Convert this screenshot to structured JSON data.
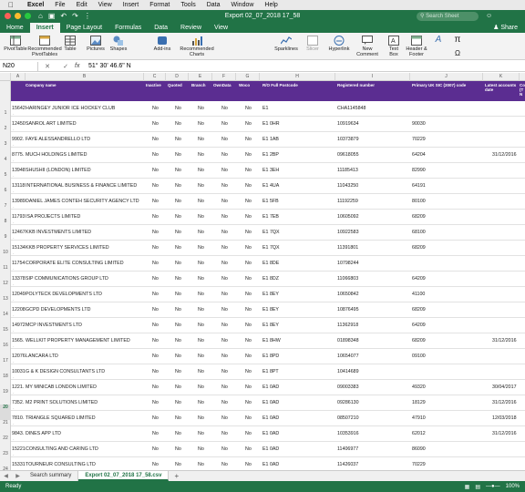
{
  "menubar": {
    "app": "Excel",
    "items": [
      "File",
      "Edit",
      "View",
      "Insert",
      "Format",
      "Tools",
      "Data",
      "Window",
      "Help"
    ]
  },
  "titlebar": {
    "title": "Export 02_07_2018 17_58",
    "search_placeholder": "Search Sheet",
    "share": "Share"
  },
  "ribbon_tabs": [
    "Home",
    "Insert",
    "Page Layout",
    "Formulas",
    "Data",
    "Review",
    "View"
  ],
  "active_tab": "Insert",
  "ribbon": {
    "pivottable": "PivotTable",
    "recommended_pivot": "Recommended PivotTables",
    "table": "Table",
    "pictures": "Pictures",
    "shapes": "Shapes",
    "addins": "Add-ins",
    "recommended_charts": "Recommended Charts",
    "sparklines": "Sparklines",
    "slicer": "Slicer",
    "hyperlink": "Hyperlink",
    "new_comment": "New Comment",
    "text_box": "Text Box",
    "header_footer": "Header & Footer"
  },
  "formula_bar": {
    "cell_ref": "N20",
    "fx": "fx",
    "value": "51° 30' 46.6\" N"
  },
  "columns": [
    "A",
    "B",
    "C",
    "D",
    "E",
    "F",
    "G",
    "H",
    "I",
    "J",
    "K",
    "L"
  ],
  "headers": {
    "company_name": "Company name",
    "inactive": "Inactive",
    "quoted": "Quoted",
    "branch": "Branch",
    "owndata": "OwnData",
    "woco": "Woco",
    "ro_full_postcode": "R/O Full Postcode",
    "registered_number": "Registered number",
    "primary_sic": "Primary UK SIC (2007) code",
    "latest_accounts": "Latest accounts date",
    "next": "Co (T N"
  },
  "rows": [
    {
      "rownum": "1",
      "id": "15642",
      "name": "HARINGEY JUNIOR ICE HOCKEY CLUB",
      "inactive": "No",
      "quoted": "No",
      "branch": "No",
      "owndata": "No",
      "woco": "No",
      "postcode": "E1",
      "regno": "CHA1145848",
      "sic": "",
      "accounts": ""
    },
    {
      "rownum": "2",
      "id": "12450",
      "name": "SANROL ART LIMITED",
      "inactive": "No",
      "quoted": "No",
      "branch": "No",
      "owndata": "No",
      "woco": "No",
      "postcode": "E1  0HR",
      "regno": "10919634",
      "sic": "90030",
      "accounts": ""
    },
    {
      "rownum": "3",
      "id": "9902.",
      "name": "FAYE ALESSANDRELLO LTD",
      "inactive": "No",
      "quoted": "No",
      "branch": "No",
      "owndata": "No",
      "woco": "No",
      "postcode": "E1  1AB",
      "regno": "10373879",
      "sic": "70229",
      "accounts": ""
    },
    {
      "rownum": "4",
      "id": "8775.",
      "name": "MUCH HOLDINGS LIMITED",
      "inactive": "No",
      "quoted": "No",
      "branch": "No",
      "owndata": "No",
      "woco": "No",
      "postcode": "E1  2BP",
      "regno": "09618055",
      "sic": "64204",
      "accounts": "31/12/2016"
    },
    {
      "rownum": "5",
      "id": "13948",
      "name": "SHUSHII (LONDON) LIMITED",
      "inactive": "No",
      "quoted": "No",
      "branch": "No",
      "owndata": "No",
      "woco": "No",
      "postcode": "E1  3EH",
      "regno": "11185413",
      "sic": "82990",
      "accounts": ""
    },
    {
      "rownum": "6",
      "id": "13118",
      "name": "INTERNATIONAL BUSINESS & FINANCE LIMITED",
      "inactive": "No",
      "quoted": "No",
      "branch": "No",
      "owndata": "No",
      "woco": "No",
      "postcode": "E1  4UA",
      "regno": "11043250",
      "sic": "64191",
      "accounts": ""
    },
    {
      "rownum": "7",
      "id": "13989",
      "name": "DANIEL JAMES CONTEH SECURITY AGENCY LTD",
      "inactive": "No",
      "quoted": "No",
      "branch": "No",
      "owndata": "No",
      "woco": "No",
      "postcode": "E1  5FB",
      "regno": "11192259",
      "sic": "80100",
      "accounts": ""
    },
    {
      "rownum": "8",
      "id": "11793",
      "name": "ISA PROJECTS LIMITED",
      "inactive": "No",
      "quoted": "No",
      "branch": "No",
      "owndata": "No",
      "woco": "No",
      "postcode": "E1  7EB",
      "regno": "10605092",
      "sic": "68209",
      "accounts": ""
    },
    {
      "rownum": "9",
      "id": "12467",
      "name": "KKB INVESTMENTS LIMITED",
      "inactive": "No",
      "quoted": "No",
      "branch": "No",
      "owndata": "No",
      "woco": "No",
      "postcode": "E1  7QX",
      "regno": "10922583",
      "sic": "68100",
      "accounts": ""
    },
    {
      "rownum": "10",
      "id": "15134",
      "name": "KKB PROPERTY SERVICES LIMITED",
      "inactive": "No",
      "quoted": "No",
      "branch": "No",
      "owndata": "No",
      "woco": "No",
      "postcode": "E1  7QX",
      "regno": "11391801",
      "sic": "68209",
      "accounts": ""
    },
    {
      "rownum": "11",
      "id": "11754",
      "name": "CORPORATE ELITE CONSULTING LIMITED",
      "inactive": "No",
      "quoted": "No",
      "branch": "No",
      "owndata": "No",
      "woco": "No",
      "postcode": "E1  8DE",
      "regno": "10798244",
      "sic": "",
      "accounts": ""
    },
    {
      "rownum": "12",
      "id": "13378",
      "name": "SIP COMMUNICATIONS GROUP LTD",
      "inactive": "No",
      "quoted": "No",
      "branch": "No",
      "owndata": "No",
      "woco": "No",
      "postcode": "E1  8DZ",
      "regno": "11066803",
      "sic": "64209",
      "accounts": ""
    },
    {
      "rownum": "13",
      "id": "12049",
      "name": "POLYTECK DEVELOPMENTS LTD",
      "inactive": "No",
      "quoted": "No",
      "branch": "No",
      "owndata": "No",
      "woco": "No",
      "postcode": "E1  8EY",
      "regno": "10650842",
      "sic": "41100",
      "accounts": ""
    },
    {
      "rownum": "14",
      "id": "12208",
      "name": "GCPD DEVELOPMENTS LTD",
      "inactive": "No",
      "quoted": "No",
      "branch": "No",
      "owndata": "No",
      "woco": "No",
      "postcode": "E1  8EY",
      "regno": "10876495",
      "sic": "68209",
      "accounts": ""
    },
    {
      "rownum": "15",
      "id": "14972",
      "name": "MCP INVESTMENTS LTD",
      "inactive": "No",
      "quoted": "No",
      "branch": "No",
      "owndata": "No",
      "woco": "No",
      "postcode": "E1  8EY",
      "regno": "11362918",
      "sic": "64209",
      "accounts": ""
    },
    {
      "rownum": "16",
      "id": "1565.",
      "name": "WELLKIT PROPERTY MANAGEMENT LIMITED",
      "inactive": "No",
      "quoted": "No",
      "branch": "No",
      "owndata": "No",
      "woco": "No",
      "postcode": "E1  8HW",
      "regno": "01898348",
      "sic": "68209",
      "accounts": "31/12/2016"
    },
    {
      "rownum": "17",
      "id": "12076",
      "name": "LANCARA LTD",
      "inactive": "No",
      "quoted": "No",
      "branch": "No",
      "owndata": "No",
      "woco": "No",
      "postcode": "E1  8PD",
      "regno": "10654077",
      "sic": "09100",
      "accounts": ""
    },
    {
      "rownum": "18",
      "id": "10031",
      "name": "G & K DESIGN CONSULTANTS LTD",
      "inactive": "No",
      "quoted": "No",
      "branch": "No",
      "owndata": "No",
      "woco": "No",
      "postcode": "E1  8PT",
      "regno": "10414689",
      "sic": "",
      "accounts": ""
    },
    {
      "rownum": "19",
      "id": "1221.",
      "name": "MY MINICAB LONDON LIMITED",
      "inactive": "No",
      "quoted": "No",
      "branch": "No",
      "owndata": "No",
      "woco": "No",
      "postcode": "E1  0AD",
      "regno": "09003383",
      "sic": "49320",
      "accounts": "30/04/2017"
    },
    {
      "rownum": "20",
      "id": "7352.",
      "name": "M2 PRINT SOLUTIONS LIMITED",
      "inactive": "No",
      "quoted": "No",
      "branch": "No",
      "owndata": "No",
      "woco": "No",
      "postcode": "E1  0AD",
      "regno": "09286130",
      "sic": "18129",
      "accounts": "31/12/2016"
    },
    {
      "rownum": "21",
      "id": "7810.",
      "name": "TRIANGLE SQUARED LIMITED",
      "inactive": "No",
      "quoted": "No",
      "branch": "No",
      "owndata": "No",
      "woco": "No",
      "postcode": "E1  0AD",
      "regno": "08507210",
      "sic": "47910",
      "accounts": "12/03/2018"
    },
    {
      "rownum": "22",
      "id": "9843.",
      "name": "DINES APP LTD",
      "inactive": "No",
      "quoted": "No",
      "branch": "No",
      "owndata": "No",
      "woco": "No",
      "postcode": "E1  0AD",
      "regno": "10353916",
      "sic": "62012",
      "accounts": "31/12/2016"
    },
    {
      "rownum": "23",
      "id": "15221",
      "name": "CONSULTING AND CARING LTD",
      "inactive": "No",
      "quoted": "No",
      "branch": "No",
      "owndata": "No",
      "woco": "No",
      "postcode": "E1  0AD",
      "regno": "11406977",
      "sic": "86090",
      "accounts": ""
    },
    {
      "rownum": "24",
      "id": "15331",
      "name": "TOURNEUR CONSULTING LTD",
      "inactive": "No",
      "quoted": "No",
      "branch": "No",
      "owndata": "No",
      "woco": "No",
      "postcode": "E1  0AD",
      "regno": "11426037",
      "sic": "70229",
      "accounts": ""
    }
  ],
  "sheet_tabs": [
    "Search summary",
    "Export 02_07_2018 17_58.csv"
  ],
  "active_sheet": "Export 02_07_2018 17_58.csv",
  "statusbar": {
    "ready": "Ready",
    "zoom": "100%"
  },
  "colors": {
    "excel_green": "#217346",
    "header_purple": "#5b2d91"
  }
}
